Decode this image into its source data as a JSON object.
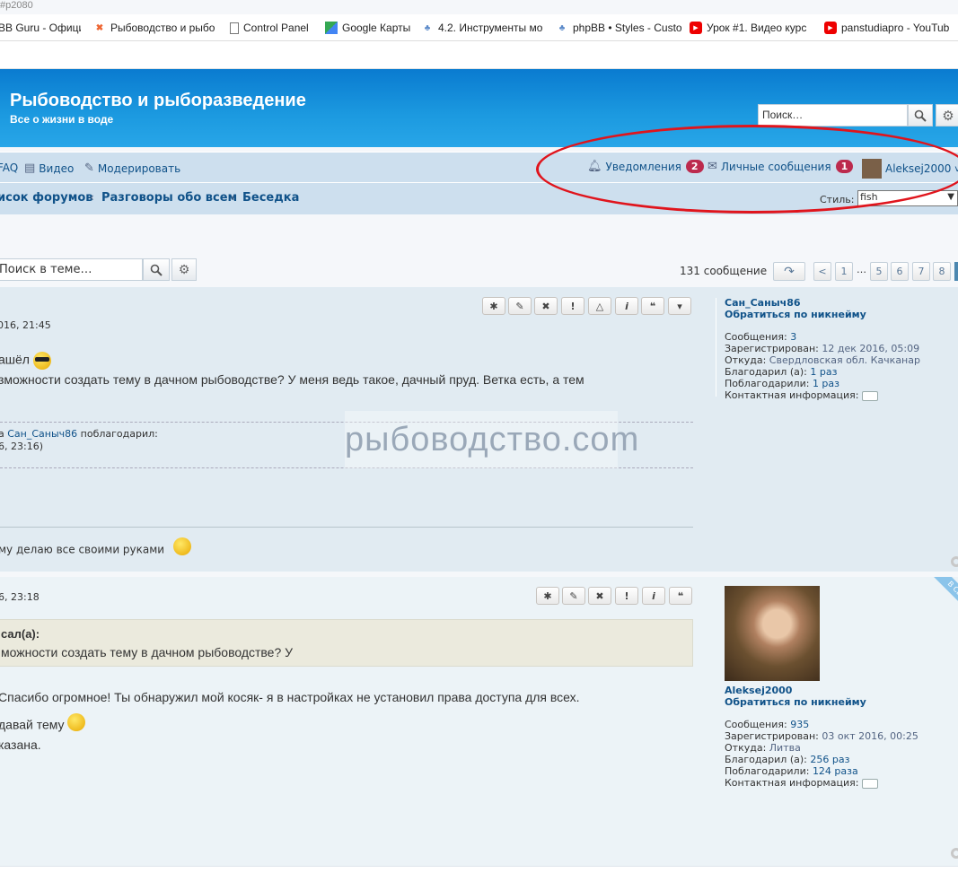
{
  "browser": {
    "url_fragment": "#p2080",
    "bookmarks": [
      {
        "label": "BB Guru - Официа",
        "icon": "page-icon"
      },
      {
        "label": "Рыбоводство и рыбо",
        "icon": "joomla-icon"
      },
      {
        "label": "Control Panel",
        "icon": "page-icon"
      },
      {
        "label": "Google Карты",
        "icon": "maps-icon"
      },
      {
        "label": "4.2. Инструменты мо",
        "icon": "people-icon"
      },
      {
        "label": "phpBB • Styles - Custo",
        "icon": "people-icon"
      },
      {
        "label": "Урок #1. Видео курс",
        "icon": "youtube-icon"
      },
      {
        "label": "panstudiapro - YouTub",
        "icon": "youtube-icon"
      }
    ]
  },
  "header": {
    "title": "Рыбоводство и рыборазведение",
    "description": "Все о жизни в воде",
    "search_placeholder": "Поиск…"
  },
  "nav": {
    "links": {
      "faq": "FAQ",
      "video": "Видео",
      "moderate": "Модерировать"
    },
    "notifications": {
      "label": "Уведомления",
      "count": "2"
    },
    "messages": {
      "label": "Личные сообщения",
      "count": "1"
    },
    "user": "Aleksej2000",
    "breadcrumbs": [
      "исок форумов",
      "Разговоры обо всем",
      "Беседка"
    ],
    "style_label": "Стиль:",
    "style_value": "fish"
  },
  "topic": {
    "search_placeholder": "Поиск в теме…",
    "post_count": "131 сообщение",
    "pages": [
      "1",
      "…",
      "5",
      "6",
      "7",
      "8"
    ]
  },
  "posts": [
    {
      "date": "016, 21:45",
      "lines": [
        "ашёл",
        "зможности создать тему в дачном рыбоводстве? У меня ведь такое, дачный пруд. Ветка есть, а тем"
      ],
      "thanks_prefix": "а",
      "thanks_user": "Сан_Саныч86",
      "thanks_suffix": "поблагодарил:",
      "thanks_date": "6, 23:16)",
      "signature": "му делаю все своими руками",
      "author": {
        "name": "Сан_Саныч86",
        "nick_link": "Обратиться по никнейму",
        "stats": [
          {
            "label": "Сообщения:",
            "value": "3",
            "link": true
          },
          {
            "label": "Зарегистрирован:",
            "value": "12 дек 2016, 05:09",
            "link": false
          },
          {
            "label": "Откуда:",
            "value": "Свердловская обл. Качканар",
            "link": false
          },
          {
            "label": "Благодарил (а):",
            "value": "1 раз",
            "link": true
          },
          {
            "label": "Поблагодарили:",
            "value": "1 раз",
            "link": true
          },
          {
            "label": "Контактная информация:",
            "value": "",
            "link": false
          }
        ]
      }
    },
    {
      "date": "6, 23:18",
      "quote_author": "сал(а):",
      "quote_text": "можности создать тему в дачном рыбоводстве? У",
      "lines": [
        "Спасибо огромное! Ты обнаружил мой косяк- я в настройках не установил права доступа для всех.",
        "давай тему",
        "казана."
      ],
      "online_label": "В СЕТИ",
      "author": {
        "name": "Aleksej2000",
        "nick_link": "Обратиться по никнейму",
        "stats": [
          {
            "label": "Сообщения:",
            "value": "935",
            "link": true
          },
          {
            "label": "Зарегистрирован:",
            "value": "03 окт 2016, 00:25",
            "link": false
          },
          {
            "label": "Откуда:",
            "value": "Литва",
            "link": false
          },
          {
            "label": "Благодарил (а):",
            "value": "256 раз",
            "link": true
          },
          {
            "label": "Поблагодарили:",
            "value": "124 раза",
            "link": true
          },
          {
            "label": "Контактная информация:",
            "value": "",
            "link": false
          }
        ]
      }
    }
  ],
  "watermark": "рыбоводство.com",
  "colors": {
    "header": "#0a7bd0",
    "link": "#105289",
    "badge": "#bc2a4d",
    "annotation": "#e0141c"
  }
}
